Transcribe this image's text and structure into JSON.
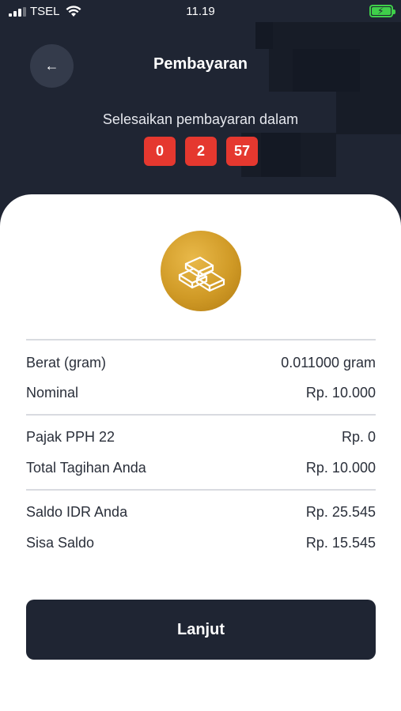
{
  "status_bar": {
    "carrier": "TSEL",
    "time": "11.19",
    "icons": [
      "signal-icon",
      "wifi-icon",
      "battery-charging-icon"
    ],
    "battery_color": "#3fcf4a"
  },
  "header": {
    "back_icon": "arrow-left-icon",
    "title": "Pembayaran",
    "countdown_label": "Selesaikan pembayaran dalam",
    "countdown": [
      "0",
      "2",
      "57"
    ],
    "countdown_color": "#e5382f"
  },
  "product": {
    "icon": "gold-bars-icon"
  },
  "summary": {
    "rows": [
      {
        "label": "Berat (gram)",
        "value": "0.011000 gram"
      },
      {
        "label": "Nominal",
        "value": "Rp. 10.000"
      },
      {
        "label": "Pajak PPH 22",
        "value": "Rp. 0"
      },
      {
        "label": "Total Tagihan Anda",
        "value": "Rp. 10.000"
      },
      {
        "label": "Saldo IDR Anda",
        "value": "Rp. 25.545"
      },
      {
        "label": "Sisa Saldo",
        "value": "Rp. 15.545"
      }
    ]
  },
  "actions": {
    "continue_label": "Lanjut"
  },
  "colors": {
    "primary_dark": "#1f2533",
    "card_bg": "#ffffff",
    "gold": "#d09a26"
  }
}
